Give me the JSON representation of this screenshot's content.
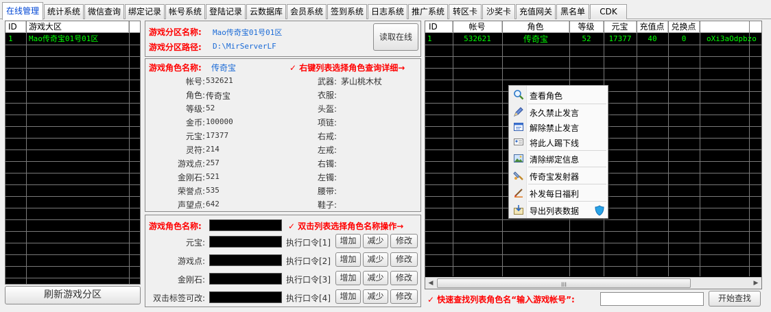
{
  "tabs": [
    "在线管理",
    "统计系统",
    "微信查询",
    "绑定记录",
    "帐号系统",
    "登陆记录",
    "云数据库",
    "会员系统",
    "签到系统",
    "日志系统",
    "推广系统",
    "转区卡",
    "沙奖卡",
    "充值网关",
    "黑名单",
    "CDK"
  ],
  "zone_list": {
    "headers": [
      "ID",
      "游戏大区"
    ],
    "rows": [
      [
        "1",
        "Mao传奇宝01号01区"
      ]
    ],
    "refresh_button": "刷新游戏分区"
  },
  "zone_info": {
    "name_label": "游戏分区名称:",
    "name_value": "Mao传奇宝01号01区",
    "path_label": "游戏分区路径:",
    "path_value": "D:\\MirServerLF",
    "read_button": "读取在线"
  },
  "role_info": {
    "title_label": "游戏角色名称:",
    "title_value": "传奇宝",
    "hint": "✓ 右键列表选择角色查询详细→",
    "left": [
      {
        "label": "帐号:",
        "value": "532621"
      },
      {
        "label": "角色:",
        "value": "传奇宝"
      },
      {
        "label": "等级:",
        "value": "52"
      },
      {
        "label": "金币:",
        "value": "100000"
      },
      {
        "label": "元宝:",
        "value": "17377"
      },
      {
        "label": "灵符:",
        "value": "214"
      },
      {
        "label": "游戏点:",
        "value": "257"
      },
      {
        "label": "金刚石:",
        "value": "521"
      },
      {
        "label": "荣誉点:",
        "value": "535"
      },
      {
        "label": "声望点:",
        "value": "642"
      }
    ],
    "right": [
      {
        "label": "武器:",
        "value": "茅山桃木杖"
      },
      {
        "label": "衣服:",
        "value": ""
      },
      {
        "label": "头盔:",
        "value": ""
      },
      {
        "label": "项链:",
        "value": ""
      },
      {
        "label": "右戒:",
        "value": ""
      },
      {
        "label": "左戒:",
        "value": ""
      },
      {
        "label": "右镯:",
        "value": ""
      },
      {
        "label": "左镯:",
        "value": ""
      },
      {
        "label": "腰带:",
        "value": ""
      },
      {
        "label": "鞋子:",
        "value": ""
      }
    ]
  },
  "ops": {
    "name_label": "游戏角色名称:",
    "hint": "✓ 双击列表选择角色名称操作→",
    "rows": [
      {
        "label": "元宝:",
        "cmd": "执行口令[1]"
      },
      {
        "label": "游戏点:",
        "cmd": "执行口令[2]"
      },
      {
        "label": "金刚石:",
        "cmd": "执行口令[3]"
      },
      {
        "label": "双击标签可改:",
        "cmd": "执行口令[4]"
      }
    ],
    "add": "增加",
    "sub": "减少",
    "mod": "修改"
  },
  "online_list": {
    "headers": [
      "ID",
      "帐号",
      "角色",
      "等级",
      "元宝",
      "充值点",
      "兑换点",
      ""
    ],
    "rows": [
      [
        "1",
        "532621",
        "传奇宝",
        "52",
        "17377",
        "40",
        "0",
        "oXi3aOdpbzo"
      ]
    ],
    "scroll_grip": "III"
  },
  "search": {
    "label": "✓ 快速查找列表角色名“输入游戏帐号”:",
    "value": "",
    "button": "开始查找"
  },
  "context_menu": [
    {
      "label": "查看角色",
      "icon": "magnifier-icon"
    },
    {
      "label": "永久禁止发言",
      "icon": "pen-icon"
    },
    {
      "label": "解除禁止发言",
      "icon": "window-icon"
    },
    {
      "label": "将此人踢下线",
      "icon": "card-icon"
    },
    {
      "label": "清除绑定信息",
      "icon": "picture-icon"
    },
    {
      "label": "传奇宝发射器",
      "icon": "tool-icon"
    },
    {
      "label": "补发每日福利",
      "icon": "brush-icon"
    },
    {
      "label": "导出列表数据",
      "icon": "export-icon"
    }
  ],
  "colors": {
    "grid_bg": "#000000",
    "grid_text": "#00ff00",
    "accent_red": "#ff0000",
    "accent_blue": "#1a6ad6"
  }
}
